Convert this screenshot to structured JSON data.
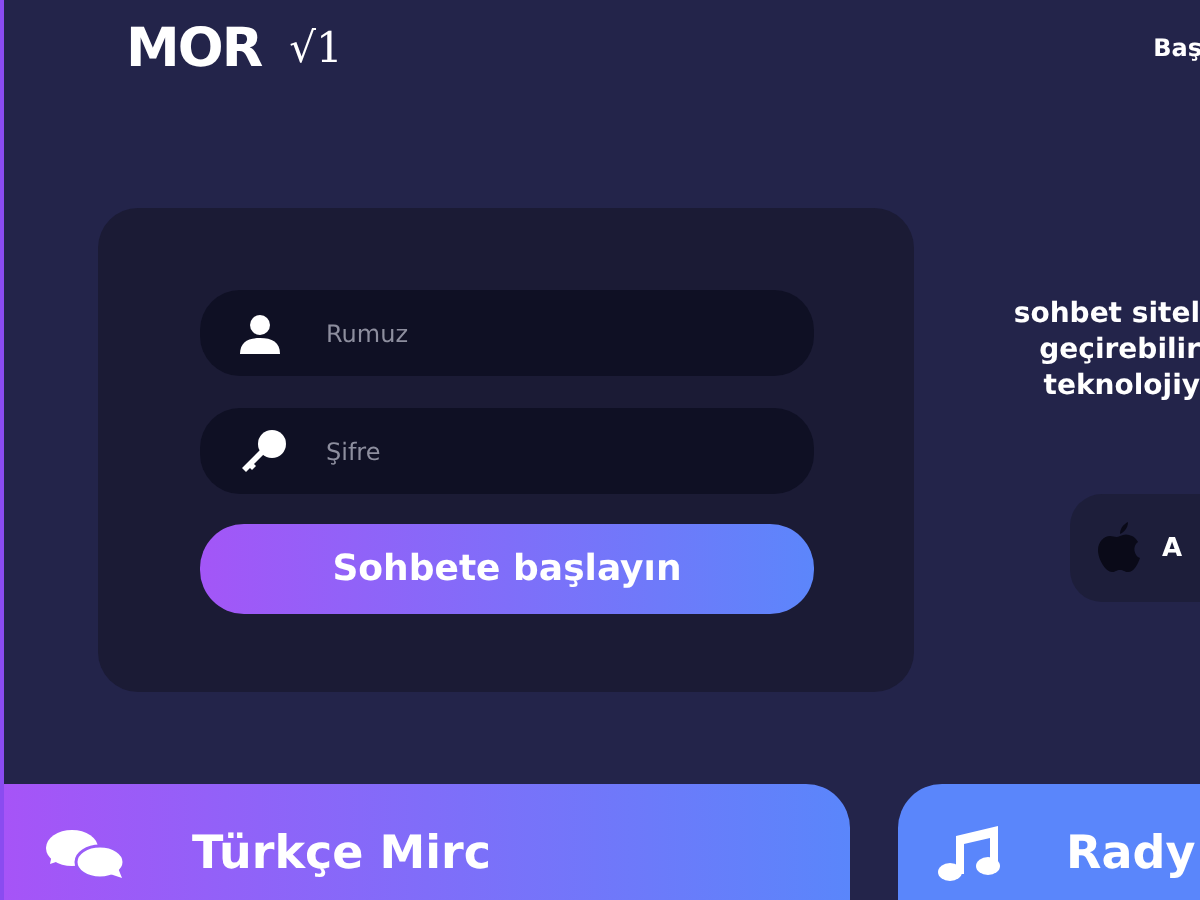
{
  "header": {
    "logo": "MOR",
    "logo_mark": "√1",
    "nav": [
      "Baş"
    ]
  },
  "login": {
    "fields": [
      {
        "kind": "user",
        "placeholder": "Rumuz"
      },
      {
        "kind": "key",
        "placeholder": "Şifre"
      }
    ],
    "submit": "Sohbete başlayın"
  },
  "intro": {
    "lines": [
      "sohbet sitel",
      "geçirebilir",
      "teknolojiy"
    ],
    "store_button": "A"
  },
  "categories": [
    {
      "kind": "chat",
      "label": "Türkçe Mirc"
    },
    {
      "kind": "music",
      "label": "Rady"
    }
  ]
}
